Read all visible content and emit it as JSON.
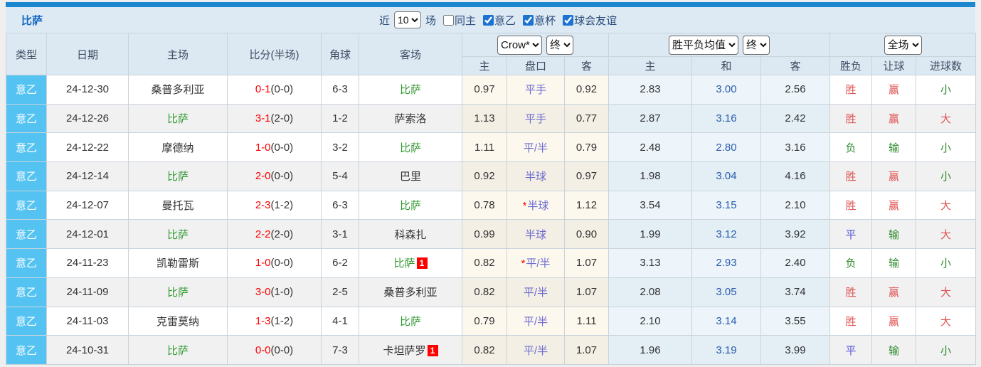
{
  "toolbar": {
    "team_title": "比萨",
    "recent_label": "近",
    "recent_value": "10",
    "matches_label": "场",
    "filters": [
      {
        "label": "同主",
        "checked": false
      },
      {
        "label": "意乙",
        "checked": true
      },
      {
        "label": "意杯",
        "checked": true
      },
      {
        "label": "球会友谊",
        "checked": true
      }
    ]
  },
  "colors": {
    "top_strip": "#1b87ce",
    "band_bg": "#dde9f3",
    "title_blue": "#1568c4",
    "league_cell_bg": "#55c3f2",
    "odds_section_bg": "#fdf8ee",
    "avg_section_bg": "#edf5fa",
    "score_red": "#ff0000",
    "focus_team_green": "#339933",
    "handicap_blue": "#6b6bd0",
    "avg_draw_blue": "#2a5db0",
    "result_red": "#e05252",
    "result_green": "#2e8b2e",
    "result_blue": "#5353d9"
  },
  "color_map": {
    "胜": "red",
    "平": "blue",
    "负": "green",
    "赢": "red",
    "输": "green",
    "大": "red",
    "小": "green"
  },
  "table": {
    "focus_team": "比萨",
    "headers": {
      "type": "类型",
      "date": "日期",
      "home": "主场",
      "score": "比分(半场)",
      "corner": "角球",
      "away": "客场",
      "odds_company": "Crow*",
      "odds_final": "终",
      "avg_label": "胜平负均值",
      "avg_final": "终",
      "fulltime_label": "全场",
      "sub": {
        "home": "主",
        "handicap": "盘口",
        "away": "客",
        "avg_home": "主",
        "avg_draw": "和",
        "avg_away": "客",
        "result": "胜负",
        "handicap_result": "让球",
        "goals": "进球数"
      }
    },
    "rows": [
      {
        "league": "意乙",
        "date": "24-12-30",
        "home": "桑普多利亚",
        "home_badge": "",
        "score": "0-1",
        "half": "(0-0)",
        "corner": "6-3",
        "away": "比萨",
        "away_badge": "",
        "odds_home": "0.97",
        "handicap": "平手",
        "star": false,
        "odds_away": "0.92",
        "avg_home": "2.83",
        "avg_draw": "3.00",
        "avg_away": "2.56",
        "result": "胜",
        "let_result": "赢",
        "goals": "小"
      },
      {
        "league": "意乙",
        "date": "24-12-26",
        "home": "比萨",
        "home_badge": "",
        "score": "3-1",
        "half": "(2-0)",
        "corner": "1-2",
        "away": "萨索洛",
        "away_badge": "",
        "odds_home": "1.13",
        "handicap": "平手",
        "star": false,
        "odds_away": "0.77",
        "avg_home": "2.87",
        "avg_draw": "3.16",
        "avg_away": "2.42",
        "result": "胜",
        "let_result": "赢",
        "goals": "大"
      },
      {
        "league": "意乙",
        "date": "24-12-22",
        "home": "摩德纳",
        "home_badge": "",
        "score": "1-0",
        "half": "(0-0)",
        "corner": "3-2",
        "away": "比萨",
        "away_badge": "",
        "odds_home": "1.11",
        "handicap": "平/半",
        "star": false,
        "odds_away": "0.79",
        "avg_home": "2.48",
        "avg_draw": "2.80",
        "avg_away": "3.16",
        "result": "负",
        "let_result": "输",
        "goals": "小"
      },
      {
        "league": "意乙",
        "date": "24-12-14",
        "home": "比萨",
        "home_badge": "",
        "score": "2-0",
        "half": "(0-0)",
        "corner": "5-4",
        "away": "巴里",
        "away_badge": "",
        "odds_home": "0.92",
        "handicap": "半球",
        "star": false,
        "odds_away": "0.97",
        "avg_home": "1.98",
        "avg_draw": "3.04",
        "avg_away": "4.16",
        "result": "胜",
        "let_result": "赢",
        "goals": "小"
      },
      {
        "league": "意乙",
        "date": "24-12-07",
        "home": "曼托瓦",
        "home_badge": "",
        "score": "2-3",
        "half": "(1-2)",
        "corner": "6-3",
        "away": "比萨",
        "away_badge": "",
        "odds_home": "0.78",
        "handicap": "半球",
        "star": true,
        "odds_away": "1.12",
        "avg_home": "3.54",
        "avg_draw": "3.15",
        "avg_away": "2.10",
        "result": "胜",
        "let_result": "赢",
        "goals": "大"
      },
      {
        "league": "意乙",
        "date": "24-12-01",
        "home": "比萨",
        "home_badge": "",
        "score": "2-2",
        "half": "(2-0)",
        "corner": "3-1",
        "away": "科森扎",
        "away_badge": "",
        "odds_home": "0.99",
        "handicap": "半球",
        "star": false,
        "odds_away": "0.90",
        "avg_home": "1.99",
        "avg_draw": "3.12",
        "avg_away": "3.92",
        "result": "平",
        "let_result": "输",
        "goals": "大"
      },
      {
        "league": "意乙",
        "date": "24-11-23",
        "home": "凯勒雷斯",
        "home_badge": "",
        "score": "1-0",
        "half": "(0-0)",
        "corner": "6-2",
        "away": "比萨",
        "away_badge": "1",
        "odds_home": "0.82",
        "handicap": "平/半",
        "star": true,
        "odds_away": "1.07",
        "avg_home": "3.13",
        "avg_draw": "2.93",
        "avg_away": "2.40",
        "result": "负",
        "let_result": "输",
        "goals": "小"
      },
      {
        "league": "意乙",
        "date": "24-11-09",
        "home": "比萨",
        "home_badge": "",
        "score": "3-0",
        "half": "(1-0)",
        "corner": "2-5",
        "away": "桑普多利亚",
        "away_badge": "",
        "odds_home": "0.82",
        "handicap": "平/半",
        "star": false,
        "odds_away": "1.07",
        "avg_home": "2.08",
        "avg_draw": "3.05",
        "avg_away": "3.74",
        "result": "胜",
        "let_result": "赢",
        "goals": "大"
      },
      {
        "league": "意乙",
        "date": "24-11-03",
        "home": "克雷莫纳",
        "home_badge": "",
        "score": "1-3",
        "half": "(1-2)",
        "corner": "4-1",
        "away": "比萨",
        "away_badge": "",
        "odds_home": "0.79",
        "handicap": "平/半",
        "star": false,
        "odds_away": "1.11",
        "avg_home": "2.10",
        "avg_draw": "3.14",
        "avg_away": "3.55",
        "result": "胜",
        "let_result": "赢",
        "goals": "大"
      },
      {
        "league": "意乙",
        "date": "24-10-31",
        "home": "比萨",
        "home_badge": "",
        "score": "0-0",
        "half": "(0-0)",
        "corner": "7-3",
        "away": "卡坦萨罗",
        "away_badge": "1",
        "odds_home": "0.82",
        "handicap": "平/半",
        "star": false,
        "odds_away": "1.07",
        "avg_home": "1.96",
        "avg_draw": "3.19",
        "avg_away": "3.99",
        "result": "平",
        "let_result": "输",
        "goals": "小"
      }
    ]
  }
}
